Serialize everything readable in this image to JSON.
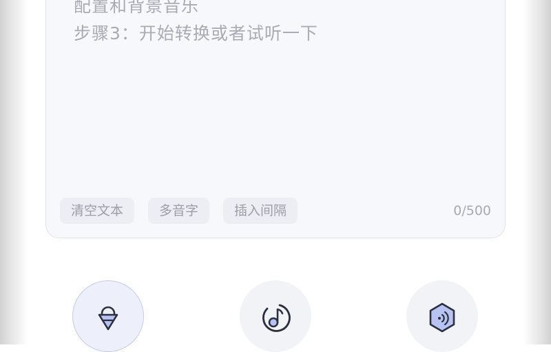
{
  "editor": {
    "text_lines": [
      "配置和背景音乐",
      "步骤3：开始转换或者试听一下"
    ],
    "char_count": "0/500"
  },
  "toolbar": {
    "clear_label": "清空文本",
    "polyphone_label": "多音字",
    "insert_pause_label": "插入间隔"
  },
  "bottom_actions": [
    {
      "icon": "voice-anchor-icon",
      "active": true
    },
    {
      "icon": "music-note-icon",
      "active": false
    },
    {
      "icon": "sound-hexagon-icon",
      "active": false
    }
  ],
  "colors": {
    "text_placeholder": "#a8abb3",
    "accent": "#5a6fd8",
    "icon_dark": "#2b2f3f"
  }
}
